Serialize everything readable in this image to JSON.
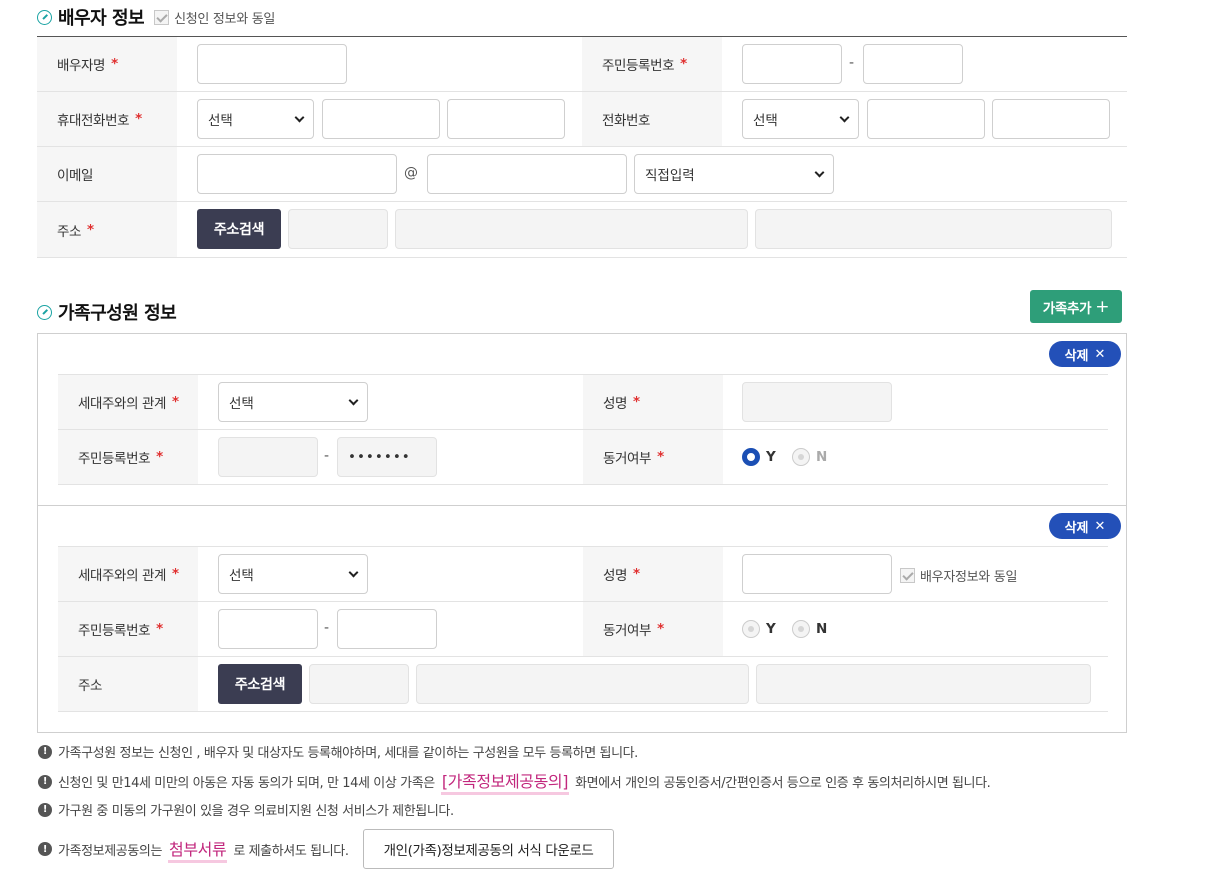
{
  "spouse": {
    "title": "배우자 정보",
    "same_as_applicant": "신청인 정보와 동일",
    "name_label": "배우자명",
    "rrn_label": "주민등록번호",
    "mobile_label": "휴대전화번호",
    "phone_label": "전화번호",
    "email_label": "이메일",
    "address_label": "주소",
    "select_default": "선택",
    "at_symbol": "@",
    "email_domain_select": "직접입력",
    "address_search_button": "주소검색",
    "dash": "-",
    "required_mark": "*"
  },
  "family": {
    "title": "가족구성원 정보",
    "add_button": "가족추가",
    "add_icon": "plus-icon",
    "delete_button": "삭제",
    "members": [
      {
        "relation_label": "세대주와의 관계",
        "relation_value": "선택",
        "name_label": "성명",
        "rrn_label": "주민등록번호",
        "rrn_back": "•••••••",
        "cohabit_label": "동거여부",
        "radio_y": "Y",
        "radio_n": "N",
        "cohabit_selected": "Y"
      },
      {
        "relation_label": "세대주와의 관계",
        "relation_value": "선택",
        "name_label": "성명",
        "same_as_spouse": "배우자정보와 동일",
        "rrn_label": "주민등록번호",
        "cohabit_label": "동거여부",
        "radio_y": "Y",
        "radio_n": "N",
        "cohabit_selected": "",
        "address_label": "주소",
        "address_search_button": "주소검색"
      }
    ]
  },
  "notes": {
    "line1": "가족구성원 정보는 신청인 , 배우자 및 대상자도 등록해야하며, 세대를 같이하는 구성원을 모두 등록하면 됩니다.",
    "line2_pre": "신청인 및 만14세 미만의 아동은 자동 동의가 되며, 만 14세 이상 가족은",
    "line2_link": "[가족정보제공동의]",
    "line2_post": "화면에서 개인의 공동인증서/간편인증서 등으로 인증 후 동의처리하시면 됩니다.",
    "line3": "가구원 중 미동의 가구원이 있을 경우 의료비지원 신청 서비스가 제한됩니다.",
    "line4_pre": "가족정보제공동의는",
    "line4_link": "첨부서류",
    "line4_post": "로 제출하셔도 됩니다.",
    "download_button": "개인(가족)정보제공동의 서식 다운로드"
  }
}
